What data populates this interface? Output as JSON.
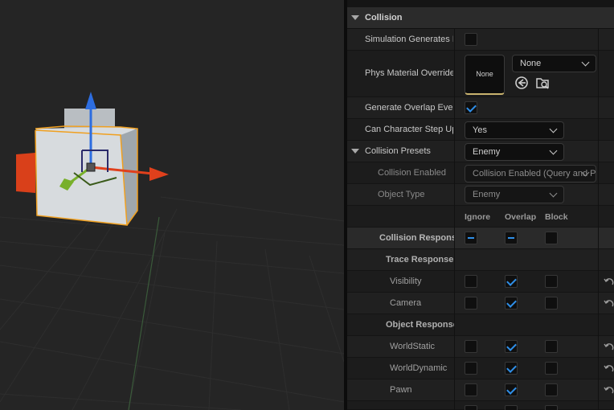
{
  "section": {
    "title": "Collision"
  },
  "properties": {
    "simulation_generates_hit_events": {
      "label": "Simulation Generates Hit Events",
      "checked": false
    },
    "phys_material_override": {
      "label": "Phys Material Override",
      "thumbnail": "None",
      "value": "None"
    },
    "generate_overlap_events": {
      "label": "Generate Overlap Events",
      "checked": true
    },
    "can_character_step_up_on": {
      "label": "Can Character Step Up On",
      "value": "Yes"
    },
    "collision_presets": {
      "label": "Collision Presets",
      "value": "Enemy"
    },
    "collision_enabled": {
      "label": "Collision Enabled",
      "value": "Collision Enabled (Query and Physics)"
    },
    "object_type": {
      "label": "Object Type",
      "value": "Enemy"
    }
  },
  "columns": {
    "ignore": "Ignore",
    "overlap": "Overlap",
    "block": "Block"
  },
  "responses": {
    "header": "Collision Responses",
    "trace_group": "Trace Responses",
    "object_group": "Object Responses",
    "rows": [
      {
        "name": "Visibility",
        "ignore": false,
        "overlap": true,
        "block": false
      },
      {
        "name": "Camera",
        "ignore": false,
        "overlap": true,
        "block": false
      },
      {
        "name": "WorldStatic",
        "ignore": false,
        "overlap": true,
        "block": false
      },
      {
        "name": "WorldDynamic",
        "ignore": false,
        "overlap": true,
        "block": false
      },
      {
        "name": "Pawn",
        "ignore": false,
        "overlap": true,
        "block": false
      }
    ]
  },
  "colors": {
    "accent_blue": "#2f8fe8",
    "gizmo_x": "#e0401c",
    "gizmo_y": "#78b02a",
    "gizmo_z": "#2d6de0",
    "selection_outline": "#f0a020"
  }
}
